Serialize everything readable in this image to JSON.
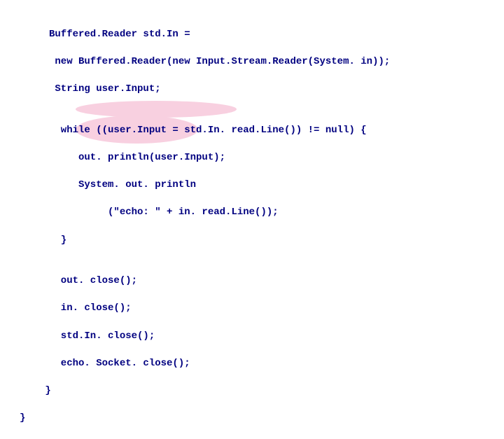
{
  "code": {
    "l1": "Buffered.Reader std.In =",
    "l2": " new Buffered.Reader(new Input.Stream.Reader(System. in));",
    "l3": " String user.Input;",
    "l4": "",
    "l5": "  while ((user.Input = std.In. read.Line()) != null) {",
    "l6": "     out. println(user.Input);",
    "l7": "     System. out. println",
    "l8": "          (\"echo: \" + in. read.Line());",
    "l9": "  }",
    "l10": "",
    "l11": "  out. close();",
    "l12": "  in. close();",
    "l13": "  std.In. close();",
    "l14": "  echo. Socket. close();",
    "l15": " }",
    "l16": "}"
  }
}
